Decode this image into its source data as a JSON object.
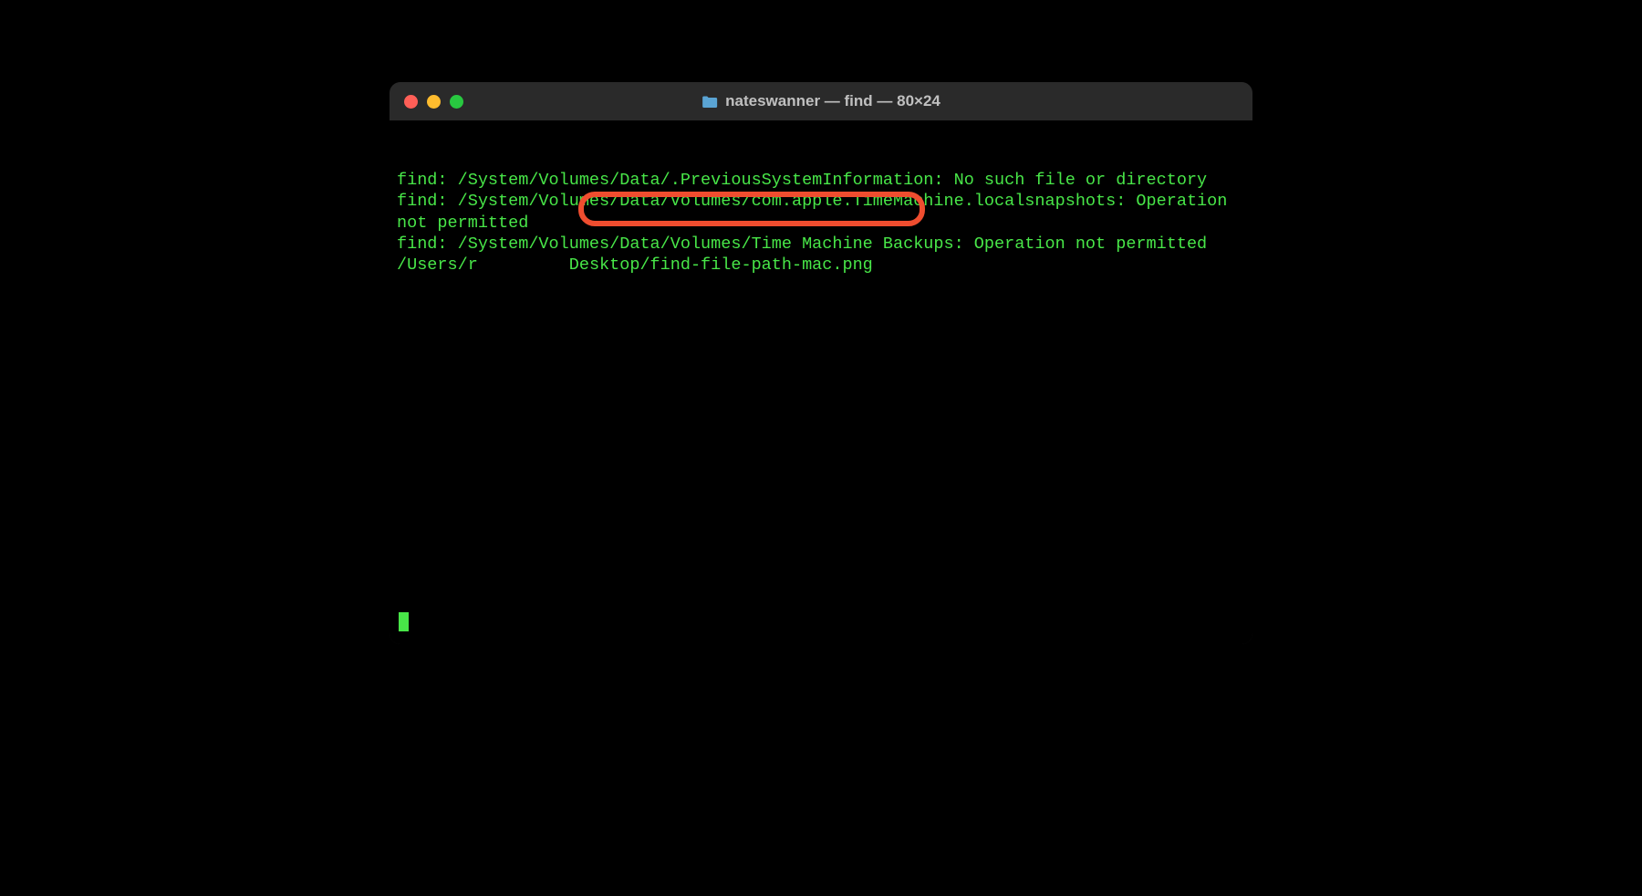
{
  "window": {
    "title": "nateswanner — find — 80×24"
  },
  "terminal": {
    "lines": [
      "find: /System/Volumes/Data/.PreviousSystemInformation: No such file or directory",
      "find: /System/Volumes/Data/Volumes/com.apple.TimeMachine.localsnapshots: Operation not permitted",
      "find: /System/Volumes/Data/Volumes/Time Machine Backups: Operation not permitted",
      "/Users/r         ",
      "Desktop/find-file-path-mac.png"
    ]
  }
}
